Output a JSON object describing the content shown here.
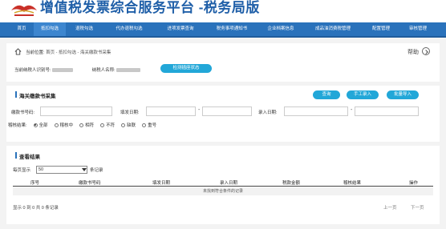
{
  "header": {
    "title": "增值税发票综合服务平台 -税务局版"
  },
  "nav": [
    {
      "label": "首页"
    },
    {
      "label": "抵扣勾选"
    },
    {
      "label": "退税勾选"
    },
    {
      "label": "代办退税勾选"
    },
    {
      "label": "进项发票查询"
    },
    {
      "label": "税务事项通知书"
    },
    {
      "label": "企业档案信息"
    },
    {
      "label": "成品油消费税管理"
    },
    {
      "label": "配置管理"
    },
    {
      "label": "审核管理"
    }
  ],
  "breadcrumb": {
    "label": "当前位置:",
    "path": "首页 - 抵扣勾选 - 海关缴款书采集"
  },
  "help": "帮助",
  "taxpayer": {
    "id_label": "当前纳税人识别号:",
    "name_label": "纳税人名称:",
    "check_button": "检测插座状态"
  },
  "search": {
    "title": "海关缴款书采集",
    "query_button": "查询",
    "manual_button": "手工录入",
    "batch_button": "批量导入",
    "number_label": "缴款书号码:",
    "date_label": "填发日期:",
    "entry_date_label": "录入日期:",
    "status_label": "稽核结果:",
    "options": [
      {
        "label": "全部",
        "checked": true
      },
      {
        "label": "稽核中",
        "checked": false
      },
      {
        "label": "相符",
        "checked": false
      },
      {
        "label": "不符",
        "checked": false
      },
      {
        "label": "缺联",
        "checked": false
      },
      {
        "label": "重号",
        "checked": false
      }
    ]
  },
  "results": {
    "title": "查看结果",
    "page_size_label": "每页显示",
    "page_size": "50",
    "per_label": "条记录",
    "columns": [
      "序号",
      "缴款书号码",
      "填发日期",
      "录入日期",
      "税款金额",
      "稽核结果",
      "操作"
    ],
    "empty_text": "未找到符合条件的记录",
    "summary": "显示 0 到 0 共 0 条记录",
    "prev": "上一页",
    "next": "下一页"
  }
}
